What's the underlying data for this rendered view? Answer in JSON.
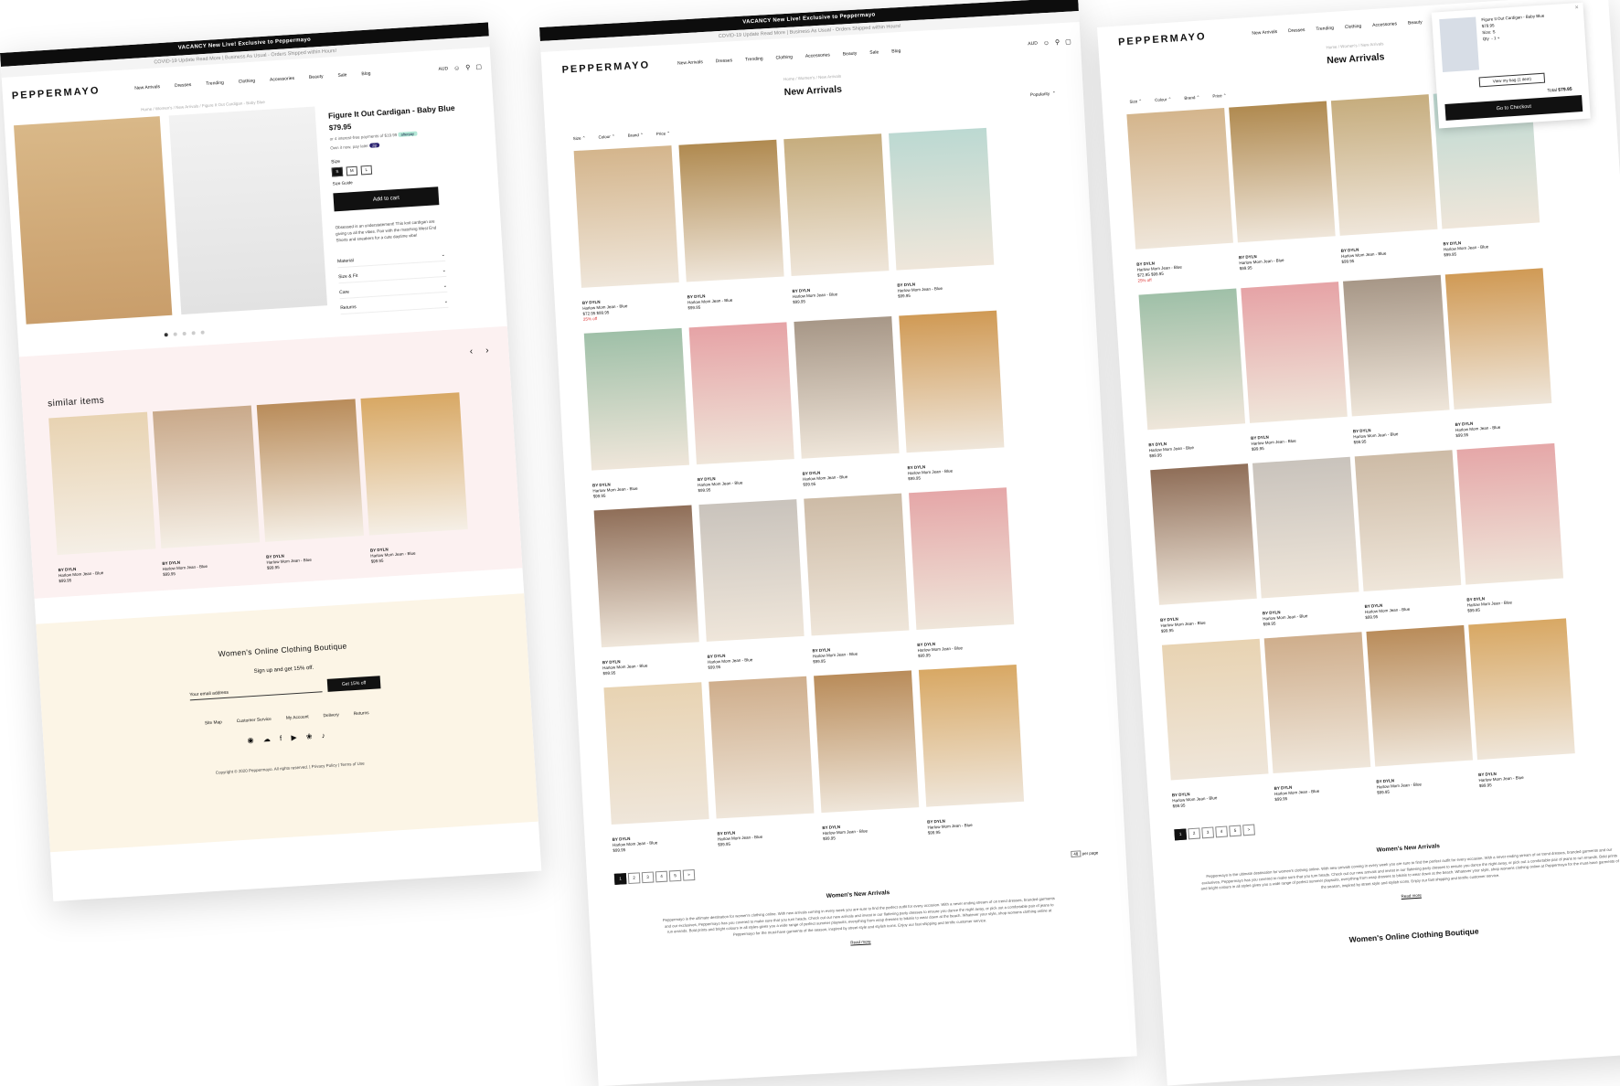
{
  "announcement": "VACANCY New Live! Exclusive to Peppermayo",
  "covid_note": "COVID-19 Update Read More | Business As Usual - Orders Shipped within Hours!",
  "brand": "PEPPERMAYO",
  "nav": [
    "New Arrivals",
    "Dresses",
    "Trending",
    "Clothing",
    "Accessories",
    "Beauty",
    "Sale",
    "Blog"
  ],
  "currency": "AUD",
  "product_page": {
    "breadcrumb": "Home / Women's / New Arrivals / Figure It Out Cardigan - Baby Blue",
    "title": "Figure It Out Cardigan - Baby Blue",
    "price": "$79.95",
    "afterpay": "or 4 interest-free payments of $19.99",
    "afterpay_badge": "afterpay",
    "zip": "Own it now, pay later",
    "zip_badge": "zip",
    "size_label": "Size",
    "sizes": [
      "S",
      "M",
      "L"
    ],
    "selected_size": "S",
    "size_guide": "Size Guide",
    "add_to_cart": "Add to cart",
    "description": "Obsessed is an understatement! This knit cardigan are giving us all the vibes. Pair with the matching West End Shorts and sneakers for a cute daytime vibe!",
    "accordion": [
      "Material",
      "Size & Fit",
      "Care",
      "Returns"
    ],
    "similar_title": "similar items",
    "similar": [
      {
        "brand": "BY DYLN",
        "name": "Harlow Mom Jean - Blue",
        "price": "$99.95",
        "color": "#e8d3b2"
      },
      {
        "brand": "BY DYLN",
        "name": "Harlow Mom Jean - Blue",
        "price": "$99.95",
        "color": "#c9a98a"
      },
      {
        "brand": "BY DYLN",
        "name": "Harlow Mom Jean - Blue",
        "price": "$99.95",
        "color": "#b98c5a"
      },
      {
        "brand": "BY DYLN",
        "name": "Harlow Mom Jean - Blue",
        "price": "$99.95",
        "color": "#d8a864"
      }
    ],
    "footer": {
      "title": "Women's Online Clothing Boutique",
      "subtitle": "Sign up and get 15% off.",
      "email_placeholder": "Your email address",
      "button": "Get 15% off",
      "links": [
        "Site Map",
        "Customer Service",
        "My Account",
        "Delivery",
        "Returns"
      ],
      "social": [
        "instagram-icon",
        "snapchat-icon",
        "facebook-icon",
        "youtube-icon",
        "twitter-icon",
        "tiktok-icon"
      ],
      "copyright": "Copyright © 2020 Peppermayo. All rights reserved. | Privacy Policy | Terms of Use"
    }
  },
  "listing_page": {
    "breadcrumb": "Home / Women's / New Arrivals",
    "title": "New Arrivals",
    "sort": "Popularity",
    "filters": [
      "Size",
      "Colour",
      "Brand",
      "Price"
    ],
    "products": [
      {
        "brand": "BY DYLN",
        "name": "Harlow Mom Jean - Blue",
        "price": "$72.95 $99.95",
        "sale": "25% off",
        "color": "#d4b58c"
      },
      {
        "brand": "BY DYLN",
        "name": "Harlow Mom Jean - Blue",
        "price": "$99.95",
        "sale": "",
        "color": "#b08a50"
      },
      {
        "brand": "BY DYLN",
        "name": "Harlow Mom Jean - Blue",
        "price": "$99.95",
        "sale": "",
        "color": "#c6ad7e"
      },
      {
        "brand": "BY DYLN",
        "name": "Harlow Mom Jean - Blue",
        "price": "$99.95",
        "sale": "",
        "color": "#bcd9d2"
      },
      {
        "brand": "BY DYLN",
        "name": "Harlow Mom Jean - Blue",
        "price": "$99.95",
        "sale": "",
        "color": "#9fc0a8"
      },
      {
        "brand": "BY DYLN",
        "name": "Harlow Mom Jean - Blue",
        "price": "$99.95",
        "sale": "",
        "color": "#e6a3a6"
      },
      {
        "brand": "BY DYLN",
        "name": "Harlow Mom Jean - Blue",
        "price": "$99.95",
        "sale": "",
        "color": "#a79787"
      },
      {
        "brand": "BY DYLN",
        "name": "Harlow Mom Jean - Blue",
        "price": "$99.95",
        "sale": "",
        "color": "#d09a55"
      },
      {
        "brand": "BY DYLN",
        "name": "Harlow Mom Jean - Blue",
        "price": "$99.95",
        "sale": "",
        "color": "#8f6e58"
      },
      {
        "brand": "BY DYLN",
        "name": "Harlow Mom Jean - Blue",
        "price": "$99.95",
        "sale": "",
        "color": "#c9c3bc"
      },
      {
        "brand": "BY DYLN",
        "name": "Harlow Mom Jean - Blue",
        "price": "$99.95",
        "sale": "",
        "color": "#cdbba6"
      },
      {
        "brand": "BY DYLN",
        "name": "Harlow Mom Jean - Blue",
        "price": "$99.95",
        "sale": "",
        "color": "#e5a7a8"
      },
      {
        "brand": "BY DYLN",
        "name": "Harlow Mom Jean - Blue",
        "price": "$99.95",
        "sale": "",
        "color": "#e8d3b2"
      },
      {
        "brand": "BY DYLN",
        "name": "Harlow Mom Jean - Blue",
        "price": "$99.95",
        "sale": "",
        "color": "#cfae8c"
      },
      {
        "brand": "BY DYLN",
        "name": "Harlow Mom Jean - Blue",
        "price": "$99.95",
        "sale": "",
        "color": "#b98c5a"
      },
      {
        "brand": "BY DYLN",
        "name": "Harlow Mom Jean - Blue",
        "price": "$99.95",
        "sale": "",
        "color": "#d8a864"
      }
    ],
    "pages": [
      "1",
      "2",
      "3",
      "4",
      "5",
      ">"
    ],
    "per_page": "48",
    "per_page_label": "per page",
    "seo_title": "Women's New Arrivals",
    "seo_text": "Peppermayo is the ultimate destination for women's clothing online. With new arrivals coming in every week you are sure to find the perfect outfit for every occasion. With a never ending stream of on trend dresses, branded garments and our exclusives, Peppermayo has you covered to make sure that you turn heads. Check out our new arrivals and invest in our flattering party dresses to ensure you dance the night away, or pick out a comfortable pair of jeans to run errands. Bold prints and bright colours in all styles gives you a wide range of perfect summer playsuits, everything from wrap dresses to bikinis to wear down at the beach. Whatever your style, shop womens clothing online at Peppermayo for the must-have garments of the season, inspired by street style and stylish icons. Enjoy our fast shipping and terrific customer service.",
    "read_more": "Read more",
    "footer_title": "Women's Online Clothing Boutique"
  },
  "mini_cart": {
    "item_name": "Figure It Out Cardigan - Baby Blue",
    "price": "$79.95",
    "size": "Size: S",
    "qty_label": "Qty",
    "view_bag": "View my bag (1 item)",
    "total_label": "Total",
    "total": "$79.95",
    "checkout": "Go to Checkout"
  }
}
